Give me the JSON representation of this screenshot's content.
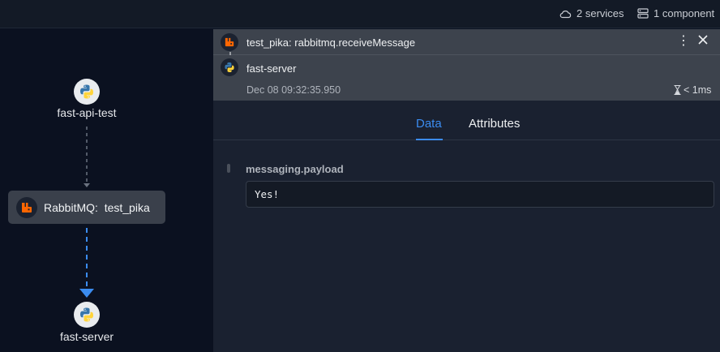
{
  "topbar": {
    "services_label": "2 services",
    "components_label": "1 component"
  },
  "graph": {
    "nodes": [
      {
        "label": "fast-api-test",
        "icon": "python-icon"
      },
      {
        "label": "RabbitMQ:  test_pika",
        "icon": "rabbitmq-icon"
      },
      {
        "label": "fast-server",
        "icon": "python-icon"
      }
    ]
  },
  "detail": {
    "title": "test_pika: rabbitmq.receiveMessage",
    "service": "fast-server",
    "timestamp": "Dec 08 09:32:35.950",
    "duration": "< 1ms",
    "tabs": [
      {
        "label": "Data",
        "active": true
      },
      {
        "label": "Attributes",
        "active": false
      }
    ],
    "field": {
      "label": "messaging.payload",
      "value": "Yes!"
    }
  },
  "colors": {
    "accent": "#3b8cf0",
    "rabbitmq": "#ff6600",
    "python_blue": "#3776ab",
    "python_yellow": "#ffd43b"
  }
}
